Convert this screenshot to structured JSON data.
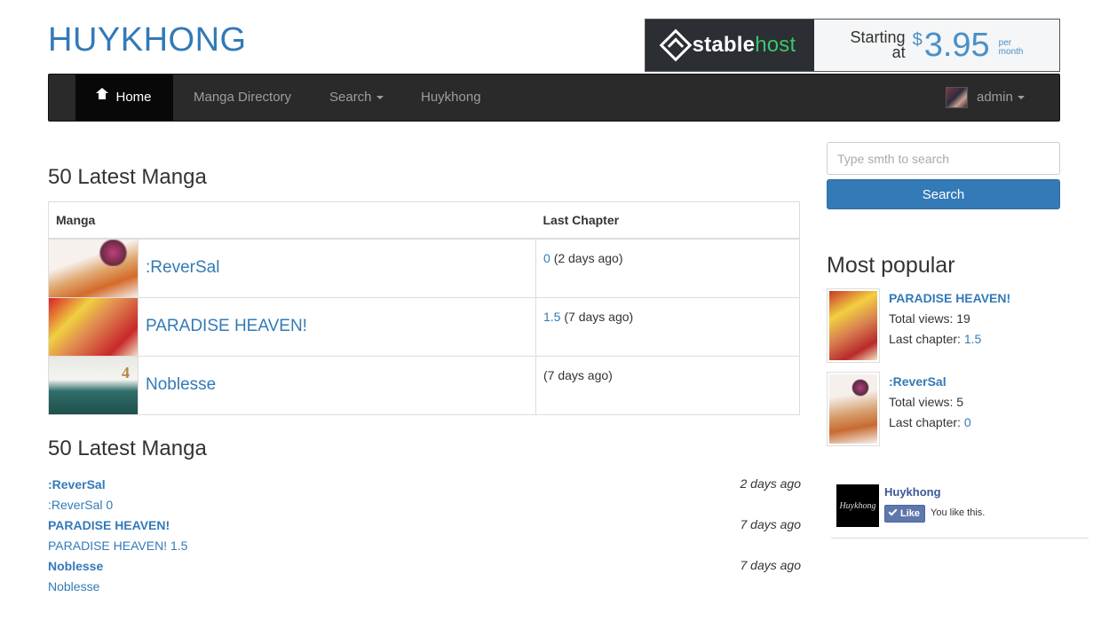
{
  "site": {
    "logo": "HUYKHONG"
  },
  "ad": {
    "brand_a": "stable",
    "brand_b": "host",
    "starting": "Starting",
    "at": "at",
    "currency": "$",
    "price": "3.95",
    "per": "per",
    "month": "month"
  },
  "nav": {
    "home": "Home",
    "directory": "Manga Directory",
    "search": "Search",
    "huykhong": "Huykhong",
    "user": "admin"
  },
  "search": {
    "placeholder": "Type smth to search",
    "button": "Search"
  },
  "table_section": {
    "heading": "50 Latest Manga",
    "columns": [
      "Manga",
      "Last Chapter"
    ],
    "rows": [
      {
        "name": ":ReverSal",
        "chapter": "0",
        "ago": "(2 days ago)"
      },
      {
        "name": "PARADISE HEAVEN!",
        "chapter": "1.5",
        "ago": "(7 days ago)"
      },
      {
        "name": "Noblesse",
        "chapter": "",
        "ago": "(7 days ago)"
      }
    ]
  },
  "list_section": {
    "heading": "50 Latest Manga",
    "items": [
      {
        "title": ":ReverSal",
        "sub": ":ReverSal 0",
        "time": "2 days ago"
      },
      {
        "title": "PARADISE HEAVEN!",
        "sub": "PARADISE HEAVEN! 1.5",
        "time": "7 days ago"
      },
      {
        "title": "Noblesse",
        "sub": "Noblesse",
        "time": "7 days ago"
      }
    ]
  },
  "popular": {
    "heading": "Most popular",
    "items": [
      {
        "title": "PARADISE HEAVEN!",
        "views_label": "Total views: ",
        "views": "19",
        "chapter_label": "Last chapter: ",
        "chapter": "1.5"
      },
      {
        "title": ":ReverSal",
        "views_label": "Total views: ",
        "views": "5",
        "chapter_label": "Last chapter: ",
        "chapter": "0"
      }
    ]
  },
  "facebook": {
    "page": "Huykhong",
    "like": "Like",
    "text": "You like this.",
    "pic_text": "Huykhong"
  }
}
